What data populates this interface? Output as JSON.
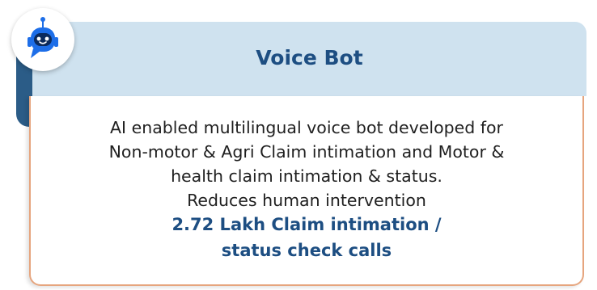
{
  "card": {
    "title": "Voice Bot",
    "icon": "robot-icon",
    "description_lines": [
      "AI enabled multilingual voice bot developed for",
      "Non-motor & Agri Claim intimation and Motor &",
      "health claim intimation & status.",
      "Reduces human intervention"
    ],
    "highlight_lines": [
      "2.72 Lakh Claim intimation /",
      "status check calls"
    ]
  },
  "colors": {
    "header_background": "#cfe2ef",
    "back_plate": "#2b5c87",
    "title_text": "#1d4e82",
    "card_border": "#e6a57e",
    "robot": "#1d6ee8"
  }
}
